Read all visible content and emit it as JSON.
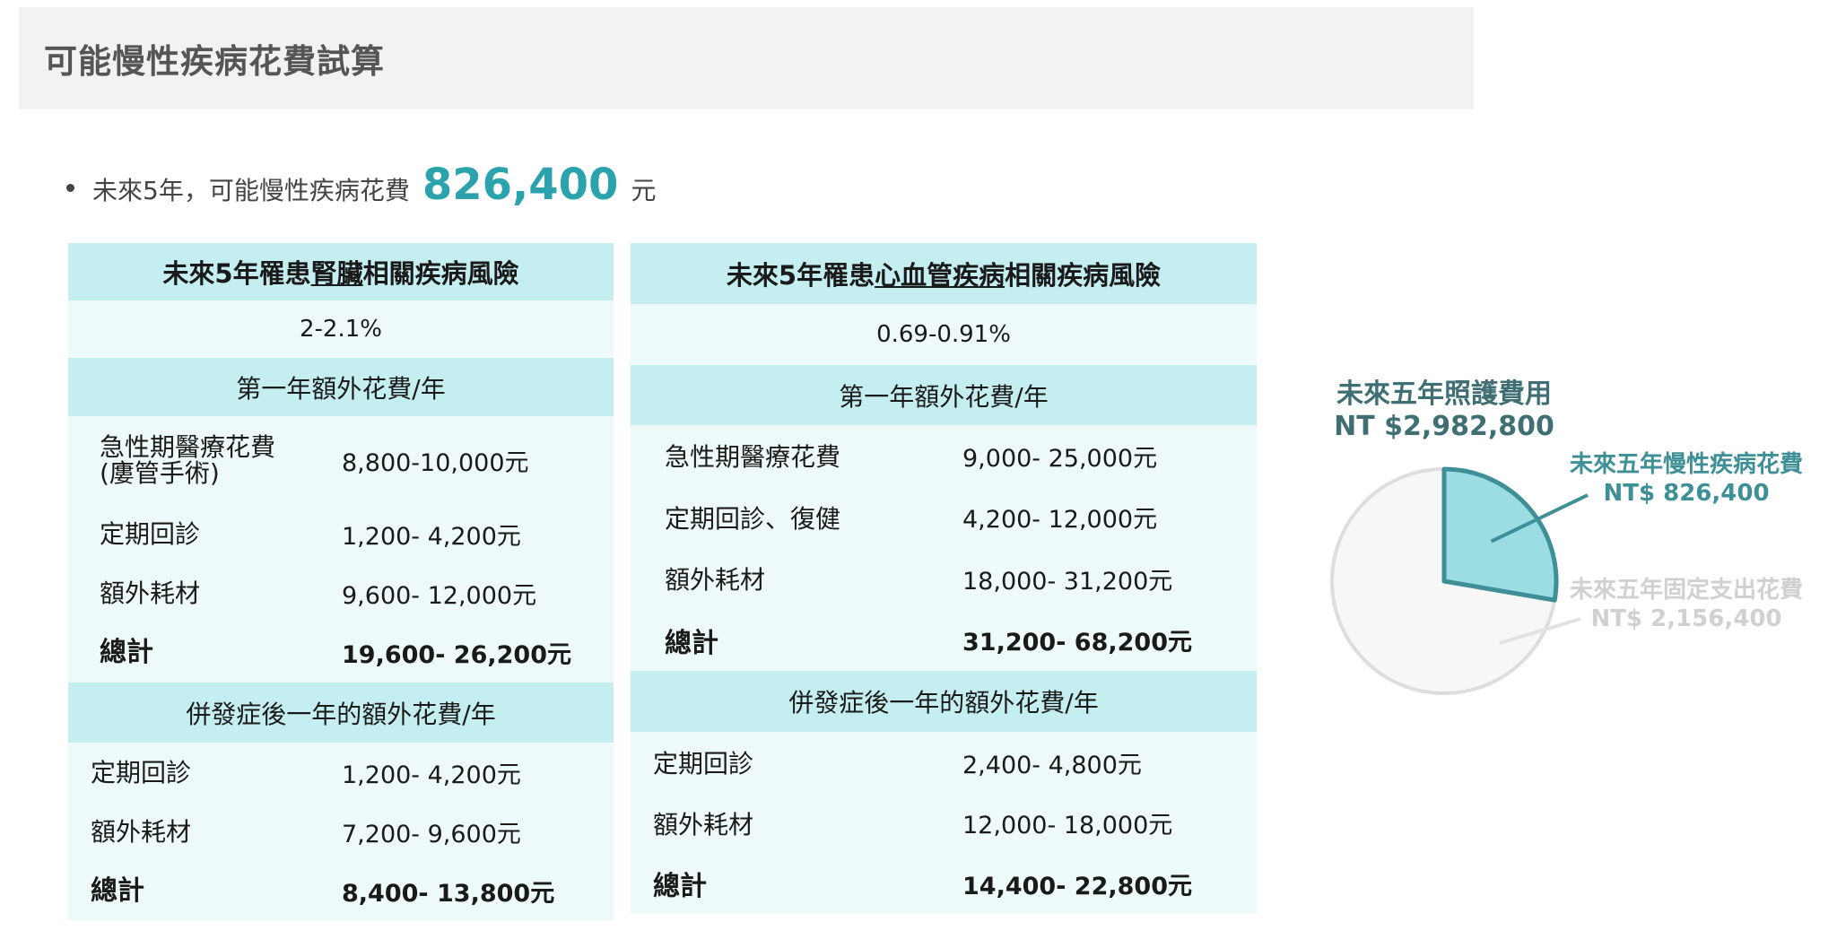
{
  "header": {
    "title": "可能慢性疾病花費試算"
  },
  "summary": {
    "prefix": "未來5年，可能慢性疾病花費",
    "amount": "826,400",
    "unit": "元"
  },
  "kidney_table": {
    "title_pre": "未來5年罹患",
    "title_under": "腎臟",
    "title_post": "相關疾病風險",
    "risk": "2-2.1%",
    "section1": "第一年額外花費/年",
    "first_year": [
      {
        "label_l1": "急性期醫療花費",
        "label_l2": "(廔管手術)",
        "value": "8,800-10,000元"
      },
      {
        "label": "定期回診",
        "value": "1,200- 4,200元"
      },
      {
        "label": "額外耗材",
        "value": "9,600- 12,000元"
      },
      {
        "label": "總計",
        "value": "19,600- 26,200元"
      }
    ],
    "section2": "併發症後一年的額外花費/年",
    "after": [
      {
        "label": "定期回診",
        "value": "1,200- 4,200元"
      },
      {
        "label": "額外耗材",
        "value": "7,200- 9,600元"
      },
      {
        "label": "總計",
        "value": "8,400- 13,800元"
      }
    ]
  },
  "cardio_table": {
    "title_pre": "未來5年罹患",
    "title_under": "心血管疾病",
    "title_post": "相關疾病風險",
    "risk": "0.69-0.91%",
    "section1": "第一年額外花費/年",
    "first_year": [
      {
        "label": "急性期醫療花費",
        "value": "9,000- 25,000元"
      },
      {
        "label": "定期回診、復健",
        "value": "4,200- 12,000元"
      },
      {
        "label": "額外耗材",
        "value": "18,000- 31,200元"
      },
      {
        "label": "總計",
        "value": "31,200- 68,200元"
      }
    ],
    "section2": "併發症後一年的額外花費/年",
    "after": [
      {
        "label": "定期回診",
        "value": "2,400- 4,800元"
      },
      {
        "label": "額外耗材",
        "value": "12,000- 18,000元"
      },
      {
        "label": "總計",
        "value": "14,400- 22,800元"
      }
    ]
  },
  "pie": {
    "title_l1": "未來五年照護費用",
    "title_l2": "NT $2,982,800",
    "chronic_l1": "未來五年慢性疾病花費",
    "chronic_l2": "NT$ 826,400",
    "fixed_l1": "未來五年固定支出花費",
    "fixed_l2": "NT$ 2,156,400",
    "chronic_value": 826400,
    "fixed_value": 2156400,
    "chronic_color": "#9bdde2",
    "chronic_stroke": "#3f8f96",
    "fixed_color": "#f7f7f7",
    "fixed_stroke": "#dddddd"
  }
}
